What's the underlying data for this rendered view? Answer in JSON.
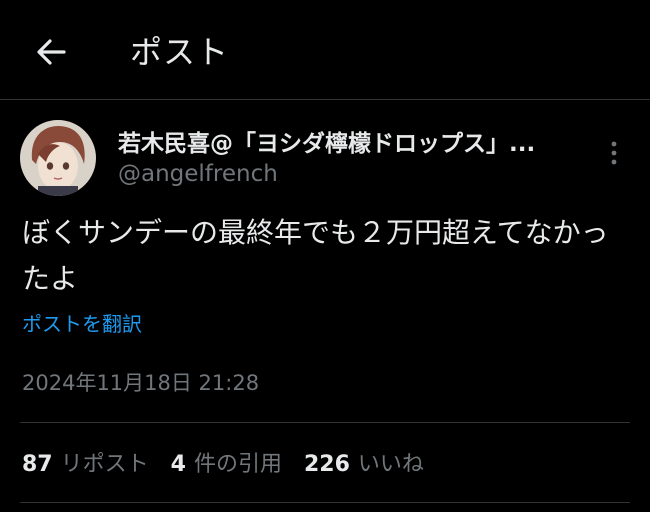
{
  "header": {
    "title": "ポスト",
    "back_icon": "arrow-left-icon"
  },
  "post": {
    "author": {
      "display_name": "若木民喜@「ヨシダ檸檬ドロップス」...",
      "handle": "@angelfrench",
      "avatar": "avatar-illustration"
    },
    "text": "ぼくサンデーの最終年でも２万円超えてなかったよ",
    "translate_label": "ポストを翻訳",
    "timestamp": "2024年11月18日 21:28",
    "more_icon": "more-vertical-icon"
  },
  "stats": [
    {
      "count": "87",
      "label": "リポスト"
    },
    {
      "count": "4",
      "label": "件の引用"
    },
    {
      "count": "226",
      "label": "いいね"
    }
  ],
  "colors": {
    "background": "#000000",
    "text": "#e7e9ea",
    "secondary_text": "#71767b",
    "link": "#1d9bf0",
    "divider": "#2f3336"
  }
}
